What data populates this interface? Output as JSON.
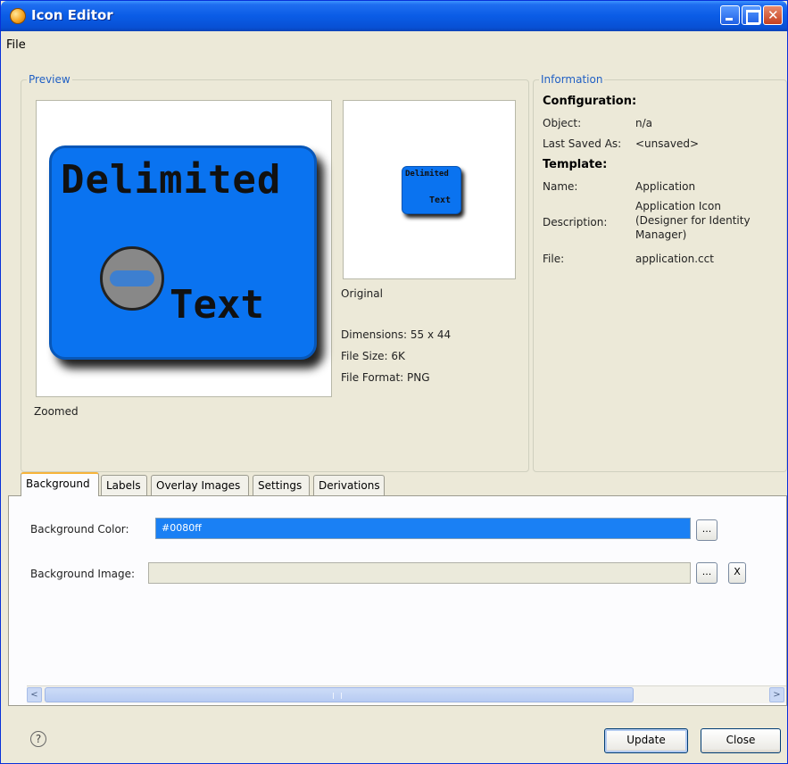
{
  "window": {
    "title": "Icon Editor"
  },
  "menu": {
    "file": "File"
  },
  "preview": {
    "group_title": "Preview",
    "zoomed_label": "Zoomed",
    "original_label": "Original",
    "dimensions": "Dimensions: 55 x 44",
    "file_size": "File Size: 6K",
    "file_format": "File Format: PNG",
    "icon_top_text": "Delimited",
    "icon_bottom_text": "Text"
  },
  "information": {
    "group_title": "Information",
    "configuration_head": "Configuration:",
    "object_label": "Object:",
    "object_value": "n/a",
    "last_saved_label": "Last Saved As:",
    "last_saved_value": "<unsaved>",
    "template_head": "Template:",
    "name_label": "Name:",
    "name_value": "Application",
    "description_label": "Description:",
    "description_value_1": "Application Icon",
    "description_value_2": "(Designer for Identity",
    "description_value_3": "Manager)",
    "file_label": "File:",
    "file_value": "application.cct"
  },
  "tabs": [
    {
      "label": "Background",
      "active": true
    },
    {
      "label": "Labels",
      "active": false
    },
    {
      "label": "Overlay Images",
      "active": false
    },
    {
      "label": "Settings",
      "active": false
    },
    {
      "label": "Derivations",
      "active": false
    }
  ],
  "background_tab": {
    "color_label": "Background Color:",
    "color_value": "#0080ff",
    "image_label": "Background Image:",
    "image_value": "",
    "browse_label": "...",
    "clear_label": "X"
  },
  "scroll": {
    "left_arrow": "<",
    "right_arrow": ">"
  },
  "buttons": {
    "update": "Update",
    "close": "Close"
  },
  "icons": {
    "help": "?"
  },
  "colors": {
    "accent": "#0080ff",
    "title_bar": "#0a5ce6"
  }
}
